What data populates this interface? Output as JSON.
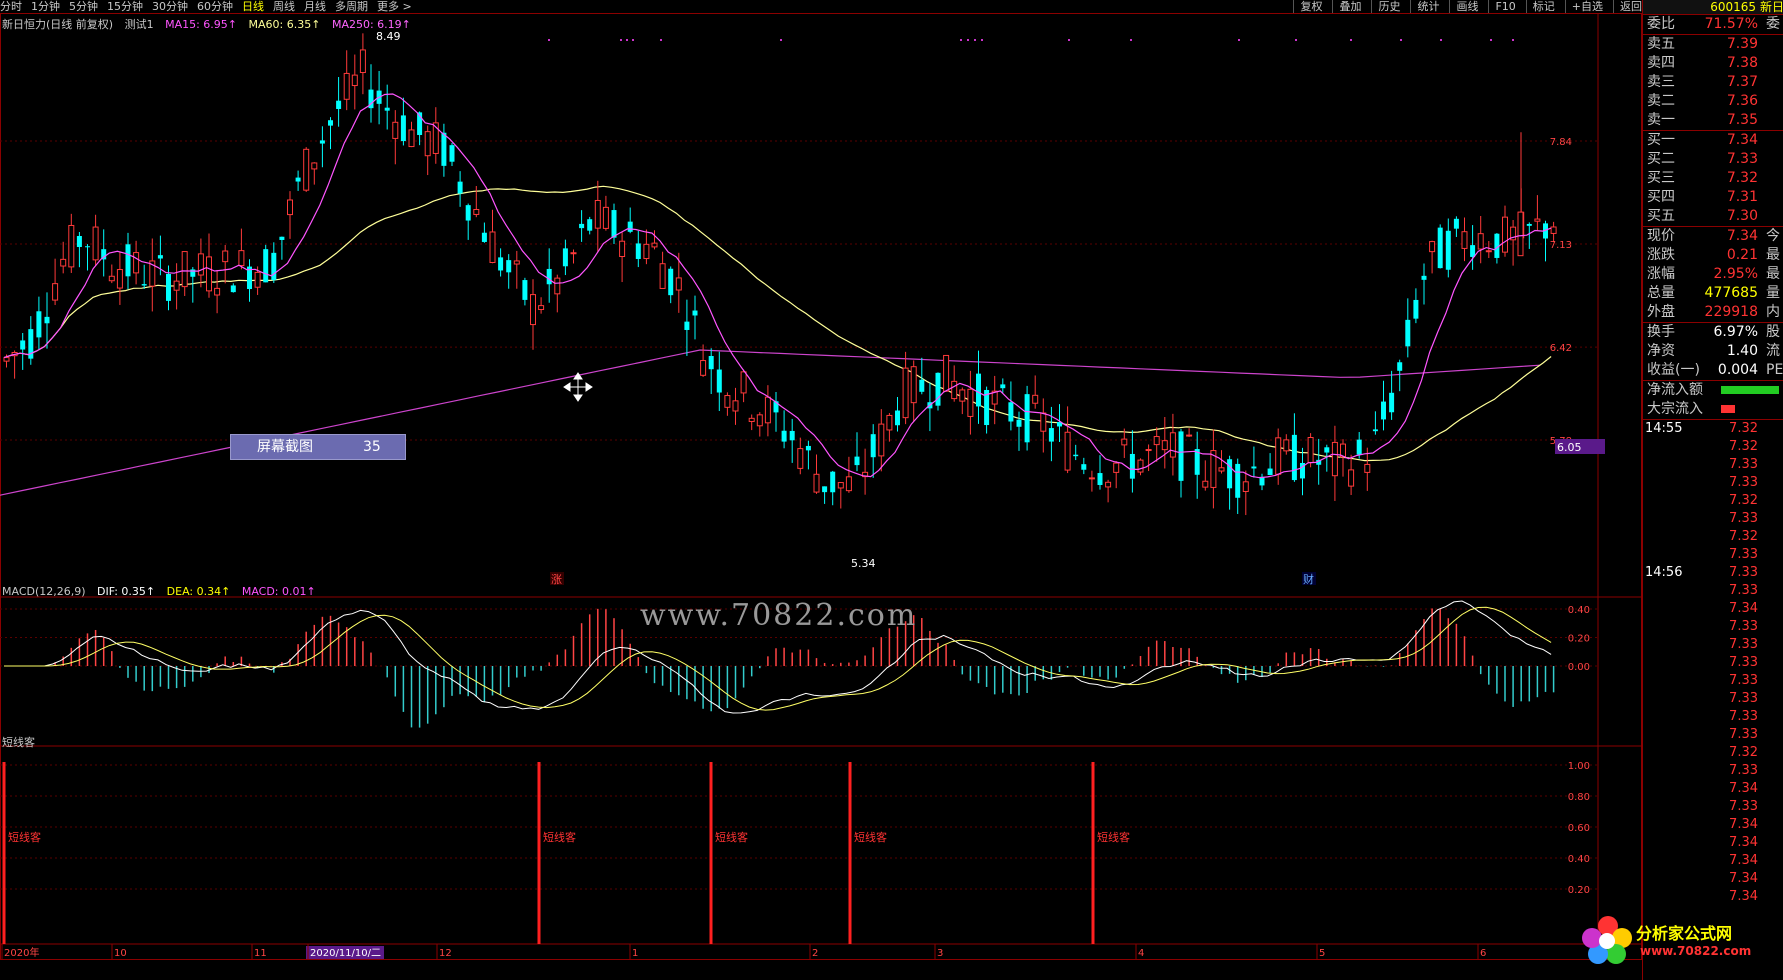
{
  "toolbar": {
    "periods": [
      "分时",
      "1分钟",
      "5分钟",
      "15分钟",
      "30分钟",
      "60分钟",
      "日线",
      "周线",
      "月线",
      "多周期",
      "更多 >"
    ],
    "active_period": "日线",
    "actions": [
      "复权",
      "叠加",
      "历史",
      "统计",
      "画线",
      "F10",
      "标记",
      "+自选",
      "返回"
    ]
  },
  "main_chart": {
    "info": {
      "name": "新日恒力(日线 前复权)",
      "indicator": "测试1",
      "ma15": "MA15: 6.95↑",
      "ma60": "MA60: 6.35↑",
      "ma250": "MA250: 6.19↑"
    },
    "price_axis": [
      "7.84",
      "7.13",
      "6.42",
      "5.78"
    ],
    "high_label": "8.49",
    "low_label": "5.34",
    "current_tag": "6.05",
    "markers": {
      "zhang": "涨",
      "cai": "财"
    },
    "colors": {
      "up": "#ff3a3a",
      "down": "#00ffff",
      "ma15": "#ff55ff",
      "ma60": "#ffff99",
      "ma250": "#cc44cc"
    }
  },
  "macd": {
    "title": "MACD(12,26,9)",
    "dif": "DIF: 0.35↑",
    "dea": "DEA: 0.34↑",
    "macd": "MACD: 0.01↑",
    "axis": [
      "0.40",
      "0.20",
      "0.00"
    ]
  },
  "short": {
    "title": "短线客",
    "label": "短线客",
    "axis": [
      "1.00",
      "0.80",
      "0.60",
      "0.40",
      "0.20"
    ]
  },
  "date_axis": [
    "2020年",
    "10",
    "11",
    "2020/11/10/二",
    "12",
    "1",
    "2",
    "3",
    "4",
    "5",
    "6"
  ],
  "tooltip": {
    "label": "屏幕截图",
    "value": "35"
  },
  "watermark": "www.70822.com",
  "logo": {
    "line1": "分析家公式网",
    "line2": "www.70822.com"
  },
  "right_panel": {
    "code": "600165",
    "name_frag": "新日",
    "webi": {
      "k": "委比",
      "v": "71.57%",
      "x": "委"
    },
    "asks": [
      {
        "k": "卖五",
        "v": "7.39"
      },
      {
        "k": "卖四",
        "v": "7.38"
      },
      {
        "k": "卖三",
        "v": "7.37"
      },
      {
        "k": "卖二",
        "v": "7.36"
      },
      {
        "k": "卖一",
        "v": "7.35"
      }
    ],
    "bids": [
      {
        "k": "买一",
        "v": "7.34"
      },
      {
        "k": "买二",
        "v": "7.33"
      },
      {
        "k": "买三",
        "v": "7.32"
      },
      {
        "k": "买四",
        "v": "7.31"
      },
      {
        "k": "买五",
        "v": "7.30"
      }
    ],
    "quote": [
      {
        "k": "现价",
        "v": "7.34",
        "x": "今",
        "c": "#ff3333"
      },
      {
        "k": "涨跌",
        "v": "0.21",
        "x": "最",
        "c": "#ff3333"
      },
      {
        "k": "涨幅",
        "v": "2.95%",
        "x": "最",
        "c": "#ff3333"
      },
      {
        "k": "总量",
        "v": "477685",
        "x": "量",
        "c": "#ffff00"
      },
      {
        "k": "外盘",
        "v": "229918",
        "x": "内",
        "c": "#ff3333"
      }
    ],
    "stats": [
      {
        "k": "换手",
        "v": "6.97%",
        "x": "股",
        "c": "#ffffff"
      },
      {
        "k": "净资",
        "v": "1.40",
        "x": "流",
        "c": "#ffffff"
      },
      {
        "k": "收益(一)",
        "v": "0.004",
        "x": "PE",
        "c": "#ffffff"
      }
    ],
    "flow": [
      {
        "k": "净流入额"
      },
      {
        "k": "大宗流入"
      }
    ],
    "ticks_a_time": "14:55",
    "ticks_a": [
      "7.32",
      "7.32",
      "7.33",
      "7.33",
      "7.32",
      "7.33",
      "7.32",
      "7.33"
    ],
    "ticks_b_time": "14:56",
    "ticks_b": [
      "7.33",
      "7.33",
      "7.34",
      "7.33",
      "7.33",
      "7.33",
      "7.33",
      "7.33",
      "7.33",
      "7.33",
      "7.32",
      "7.33",
      "7.34",
      "7.33",
      "7.34",
      "7.34",
      "7.34",
      "7.34",
      "7.34"
    ]
  }
}
